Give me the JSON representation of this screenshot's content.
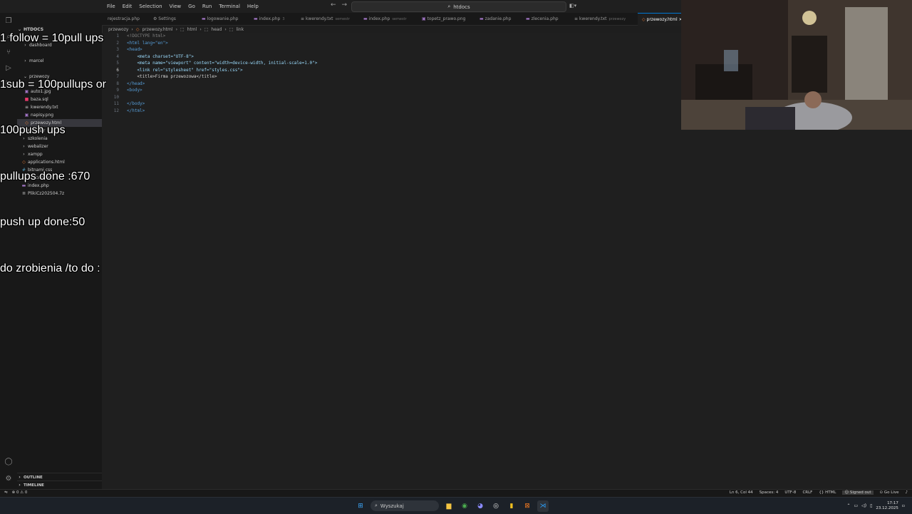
{
  "titlebar": {
    "menu": [
      "File",
      "Edit",
      "Selection",
      "View",
      "Go",
      "Run",
      "Terminal",
      "Help"
    ],
    "search": "htdocs"
  },
  "overlay": {
    "lines": [
      "1 follow = 10pull ups",
      "1sub = 100pullups or",
      "100push ups",
      "pullups done :670",
      "push up done:50",
      "do zrobienia /to do :"
    ]
  },
  "explorer": {
    "root": "HTDOCS",
    "items": [
      {
        "label": "dashboard",
        "icon": "folder"
      },
      {
        "label": "marcel",
        "icon": "folder"
      },
      {
        "label": "przewozy",
        "icon": "folder"
      },
      {
        "label": "auto1.jpg",
        "icon": "image"
      },
      {
        "label": "baza.sql",
        "icon": "database"
      },
      {
        "label": "kwerendy.txt",
        "icon": "text"
      },
      {
        "label": "napisy.png",
        "icon": "image"
      },
      {
        "label": "przewozy.html",
        "icon": "html"
      },
      {
        "label": "semestr",
        "icon": "folder"
      },
      {
        "label": "szkolenia",
        "icon": "folder"
      },
      {
        "label": "webalizer",
        "icon": "folder"
      },
      {
        "label": "xampp",
        "icon": "folder"
      },
      {
        "label": "applications.html",
        "icon": "html"
      },
      {
        "label": "bitnami.css",
        "icon": "css"
      },
      {
        "label": "favicon.ico",
        "icon": "ico"
      },
      {
        "label": "index.php",
        "icon": "php"
      },
      {
        "label": "PlikiCz202504.7z",
        "icon": "archive"
      }
    ],
    "outline": "OUTLINE",
    "timeline": "TIMELINE"
  },
  "tabs": [
    {
      "label": "rejestracja.php",
      "desc": ""
    },
    {
      "label": "Settings",
      "desc": ""
    },
    {
      "label": "logowanie.php",
      "desc": ""
    },
    {
      "label": "index.php",
      "desc": "3"
    },
    {
      "label": "kwerendy.txt",
      "desc": "semestr"
    },
    {
      "label": "index.php",
      "desc": "semestr"
    },
    {
      "label": "topetz_prawo.png",
      "desc": ""
    },
    {
      "label": "zadanie.php",
      "desc": ""
    },
    {
      "label": "zlecenia.php",
      "desc": ""
    },
    {
      "label": "kwerendy.txt",
      "desc": "przewozy"
    },
    {
      "label": "przewozy.html",
      "desc": ""
    }
  ],
  "breadcrumb": [
    "przewozy",
    "przewozy.html",
    "html",
    "head",
    "link"
  ],
  "editor": {
    "line_numbers": [
      "1",
      "2",
      "3",
      "4",
      "5",
      "6",
      "7",
      "8",
      "9",
      "10",
      "11",
      "12"
    ],
    "current_line": 6,
    "lines": [
      [
        "<!DOCTYPE html>"
      ],
      [
        "<html lang=\"en\">"
      ],
      [
        "<head>"
      ],
      [
        "    <meta charset=\"UTF-8\">"
      ],
      [
        "    <meta name=\"viewport\" content=\"width=device-width, initial-scale=1.0\">"
      ],
      [
        "    <link rel=\"stylesheet\" href=\"styles.css\">"
      ],
      [
        "    <title>Firma przewozowa</title>"
      ],
      [
        "</head>"
      ],
      [
        "<body>"
      ],
      [
        ""
      ],
      [
        "</body>"
      ],
      [
        "</html>"
      ]
    ]
  },
  "statusbar": {
    "left": [
      "⊗ 0 ⚠ 0"
    ],
    "position": "Ln 6, Col 44",
    "spaces": "Spaces: 4",
    "encoding": "UTF-8",
    "eol": "CRLF",
    "language": "{} HTML",
    "account": "Signed out",
    "golive": "Go Live"
  },
  "taskbar": {
    "search": "Wyszukaj",
    "time": "17:17",
    "date": "23.12.2025"
  },
  "colors": {
    "editor_bg": "#1f1f1f",
    "sidebar_bg": "#181818",
    "accent": "#0078d4",
    "tag": "#569cd6",
    "attr": "#9cdcfe",
    "string": "#ce9178"
  }
}
